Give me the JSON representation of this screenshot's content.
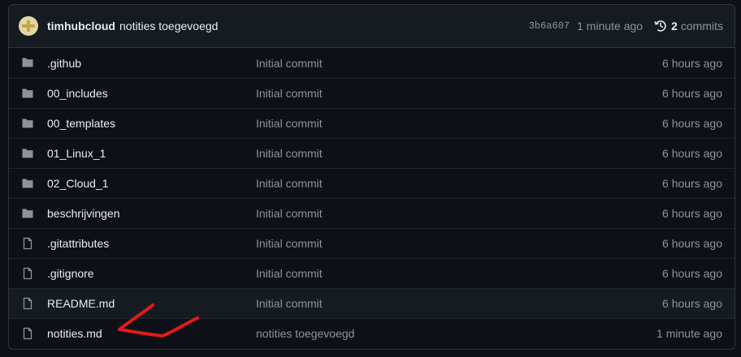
{
  "commit_bar": {
    "author": "timhubcloud",
    "message": "notities toegevoegd",
    "sha": "3b6a607",
    "time": "1 minute ago",
    "commits_count": "2",
    "commits_label": "commits",
    "history_icon": "history-icon"
  },
  "files": [
    {
      "name": ".github",
      "type": "folder",
      "message": "Initial commit",
      "time": "6 hours ago"
    },
    {
      "name": "00_includes",
      "type": "folder",
      "message": "Initial commit",
      "time": "6 hours ago"
    },
    {
      "name": "00_templates",
      "type": "folder",
      "message": "Initial commit",
      "time": "6 hours ago"
    },
    {
      "name": "01_Linux_1",
      "type": "folder",
      "message": "Initial commit",
      "time": "6 hours ago"
    },
    {
      "name": "02_Cloud_1",
      "type": "folder",
      "message": "Initial commit",
      "time": "6 hours ago"
    },
    {
      "name": "beschrijvingen",
      "type": "folder",
      "message": "Initial commit",
      "time": "6 hours ago"
    },
    {
      "name": ".gitattributes",
      "type": "file",
      "message": "Initial commit",
      "time": "6 hours ago"
    },
    {
      "name": ".gitignore",
      "type": "file",
      "message": "Initial commit",
      "time": "6 hours ago"
    },
    {
      "name": "README.md",
      "type": "file",
      "message": "Initial commit",
      "time": "6 hours ago"
    },
    {
      "name": "notities.md",
      "type": "file",
      "message": "notities toegevoegd",
      "time": "1 minute ago"
    }
  ],
  "colors": {
    "background": "#0d1117",
    "border": "#30363d",
    "muted": "#8b949e",
    "text": "#e6edf3",
    "annotation_arrow": "#e01b1b"
  }
}
